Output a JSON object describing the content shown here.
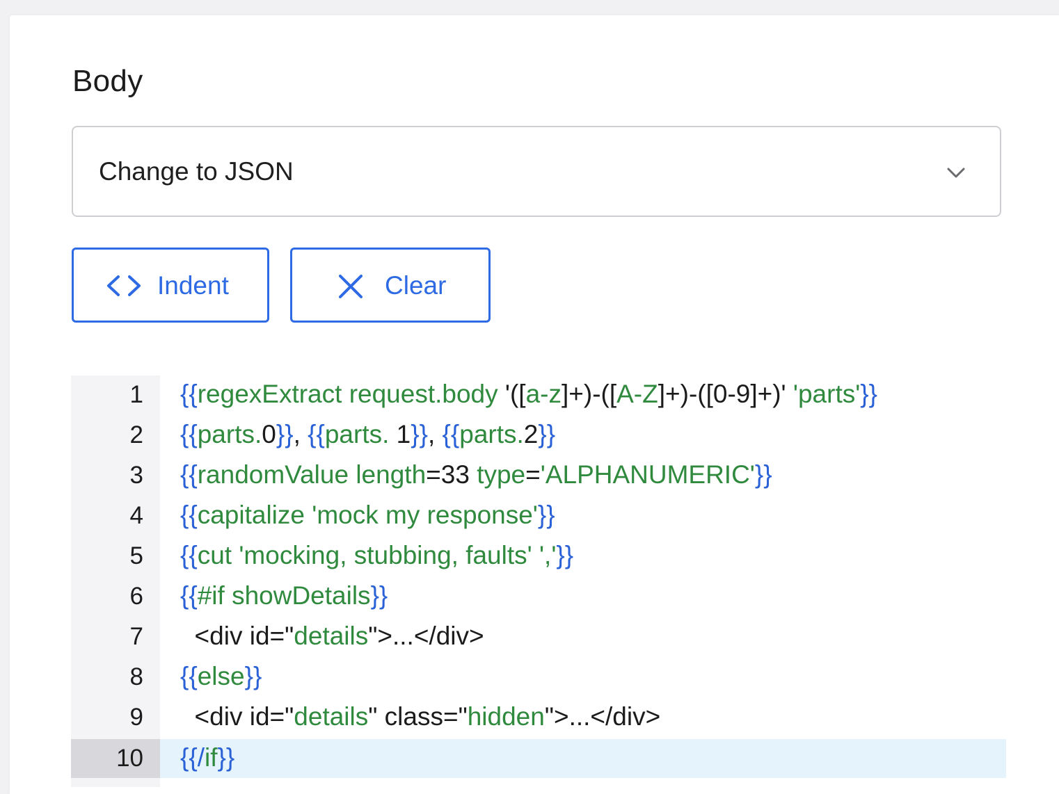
{
  "body": {
    "title": "Body",
    "select": {
      "value": "Change to JSON",
      "icon": "chevron-down-icon"
    },
    "buttons": {
      "indent": {
        "label": "Indent",
        "icon": "code-brackets-icon"
      },
      "clear": {
        "label": "Clear",
        "icon": "close-icon"
      }
    },
    "editor": {
      "active_line": 10,
      "colors": {
        "tag": "#2a61d6",
        "string": "#2f8a3e",
        "plain": "#1b1b1b"
      },
      "lines": [
        {
          "num": "1",
          "tokens": [
            {
              "t": "{{",
              "c": "b"
            },
            {
              "t": "regexExtract request.body ",
              "c": "g"
            },
            {
              "t": "'([",
              "c": "k"
            },
            {
              "t": "a-z",
              "c": "g"
            },
            {
              "t": "]+)-([",
              "c": "k"
            },
            {
              "t": "A-Z",
              "c": "g"
            },
            {
              "t": "]+)-([0-9]+)' ",
              "c": "k"
            },
            {
              "t": "'parts'",
              "c": "g"
            },
            {
              "t": "}}",
              "c": "b"
            }
          ]
        },
        {
          "num": "2",
          "tokens": [
            {
              "t": "{{",
              "c": "b"
            },
            {
              "t": "parts.",
              "c": "g"
            },
            {
              "t": "0",
              "c": "k"
            },
            {
              "t": "}}",
              "c": "b"
            },
            {
              "t": ", ",
              "c": "k"
            },
            {
              "t": "{{",
              "c": "b"
            },
            {
              "t": "parts.",
              "c": "g"
            },
            {
              "t": " 1",
              "c": "k"
            },
            {
              "t": "}}",
              "c": "b"
            },
            {
              "t": ", ",
              "c": "k"
            },
            {
              "t": "{{",
              "c": "b"
            },
            {
              "t": "parts.",
              "c": "g"
            },
            {
              "t": "2",
              "c": "k"
            },
            {
              "t": "}}",
              "c": "b"
            }
          ]
        },
        {
          "num": "3",
          "tokens": [
            {
              "t": "{{",
              "c": "b"
            },
            {
              "t": "randomValue length",
              "c": "g"
            },
            {
              "t": "=33 ",
              "c": "k"
            },
            {
              "t": "type",
              "c": "g"
            },
            {
              "t": "=",
              "c": "k"
            },
            {
              "t": "'ALPHANUMERIC'",
              "c": "g"
            },
            {
              "t": "}}",
              "c": "b"
            }
          ]
        },
        {
          "num": "4",
          "tokens": [
            {
              "t": "{{",
              "c": "b"
            },
            {
              "t": "capitalize 'mock my response'",
              "c": "g"
            },
            {
              "t": "}}",
              "c": "b"
            }
          ]
        },
        {
          "num": "5",
          "tokens": [
            {
              "t": "{{",
              "c": "b"
            },
            {
              "t": "cut 'mocking, stubbing, faults' ','",
              "c": "g"
            },
            {
              "t": "}}",
              "c": "b"
            }
          ]
        },
        {
          "num": "6",
          "tokens": [
            {
              "t": "{{",
              "c": "b"
            },
            {
              "t": "#if showDetails",
              "c": "g"
            },
            {
              "t": "}}",
              "c": "b"
            }
          ]
        },
        {
          "num": "7",
          "tokens": [
            {
              "t": "  <div id=\"",
              "c": "k"
            },
            {
              "t": "details",
              "c": "g"
            },
            {
              "t": "\">...</div>",
              "c": "k"
            }
          ]
        },
        {
          "num": "8",
          "tokens": [
            {
              "t": "{{",
              "c": "b"
            },
            {
              "t": "else",
              "c": "g"
            },
            {
              "t": "}}",
              "c": "b"
            }
          ]
        },
        {
          "num": "9",
          "tokens": [
            {
              "t": "  <div id=\"",
              "c": "k"
            },
            {
              "t": "details",
              "c": "g"
            },
            {
              "t": "\" class=\"",
              "c": "k"
            },
            {
              "t": "hidden",
              "c": "g"
            },
            {
              "t": "\">...</div>",
              "c": "k"
            }
          ]
        },
        {
          "num": "10",
          "tokens": [
            {
              "t": "{{/",
              "c": "b"
            },
            {
              "t": "if",
              "c": "g"
            },
            {
              "t": "}}",
              "c": "b"
            }
          ]
        }
      ]
    }
  }
}
